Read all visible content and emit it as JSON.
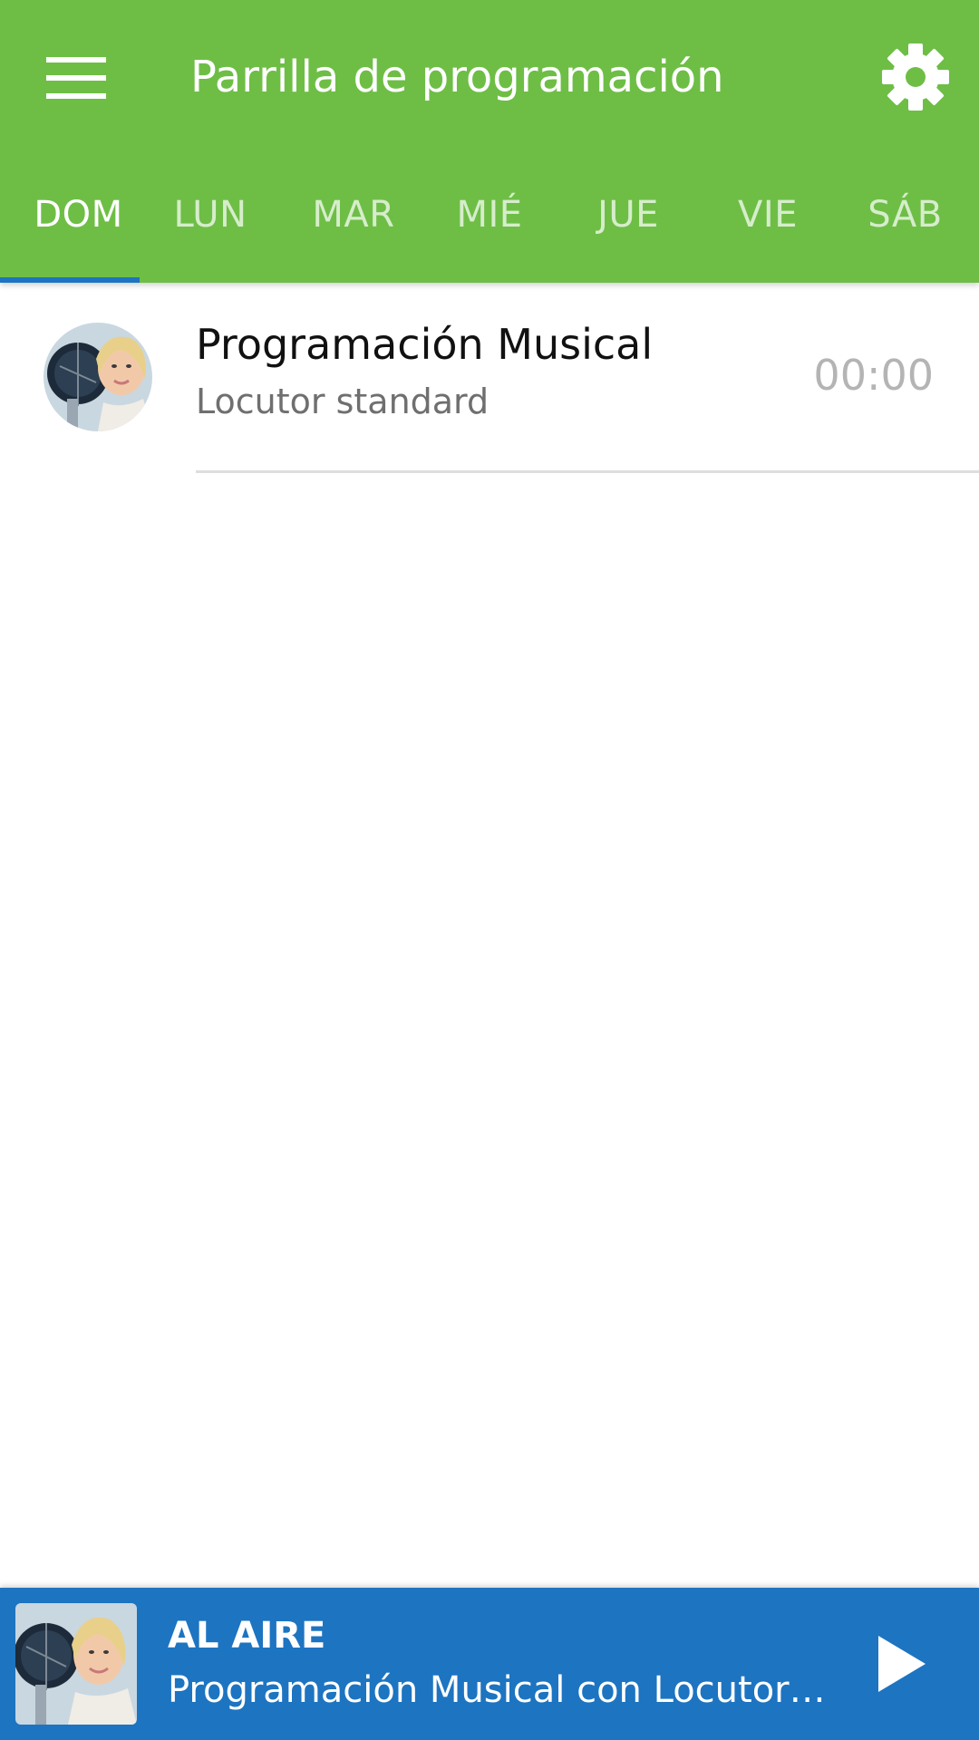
{
  "header": {
    "title": "Parrilla de programación",
    "menu_icon": "menu-icon",
    "settings_icon": "gear-icon",
    "background_color": "#6ebe46"
  },
  "tabs": [
    {
      "label": "DOM",
      "active": true
    },
    {
      "label": "LUN",
      "active": false
    },
    {
      "label": "MAR",
      "active": false
    },
    {
      "label": "MIÉ",
      "active": false
    },
    {
      "label": "JUE",
      "active": false
    },
    {
      "label": "VIE",
      "active": false
    },
    {
      "label": "SÁB",
      "active": false
    }
  ],
  "tab_indicator_color": "#1d74c1",
  "schedule": [
    {
      "title": "Programación Musical",
      "host": "Locutor standard",
      "time": "00:00",
      "avatar": "host-avatar"
    }
  ],
  "player": {
    "label": "AL AIRE",
    "track": "Programación Musical con Locutor standard",
    "art": "host-photo",
    "play_icon": "play-icon",
    "background_color": "#1d74c1"
  }
}
